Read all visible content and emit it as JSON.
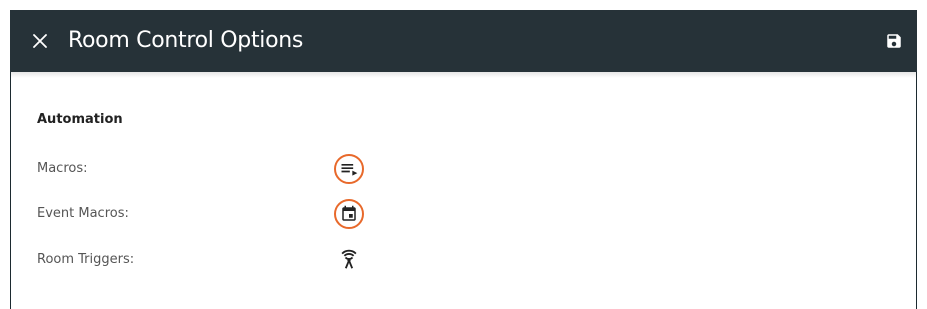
{
  "header": {
    "title": "Room Control Options",
    "close_icon": "close-icon",
    "save_icon": "save-icon"
  },
  "section": {
    "title": "Automation"
  },
  "rows": [
    {
      "label": "Macros:",
      "icon": "playlist-play-icon",
      "highlighted": true
    },
    {
      "label": "Event Macros:",
      "icon": "calendar-event-icon",
      "highlighted": true
    },
    {
      "label": "Room Triggers:",
      "icon": "wireless-antenna-icon",
      "highlighted": false
    }
  ],
  "colors": {
    "appbar": "#263238",
    "highlight_ring": "#e8692b",
    "title_text": "#ffffff"
  }
}
